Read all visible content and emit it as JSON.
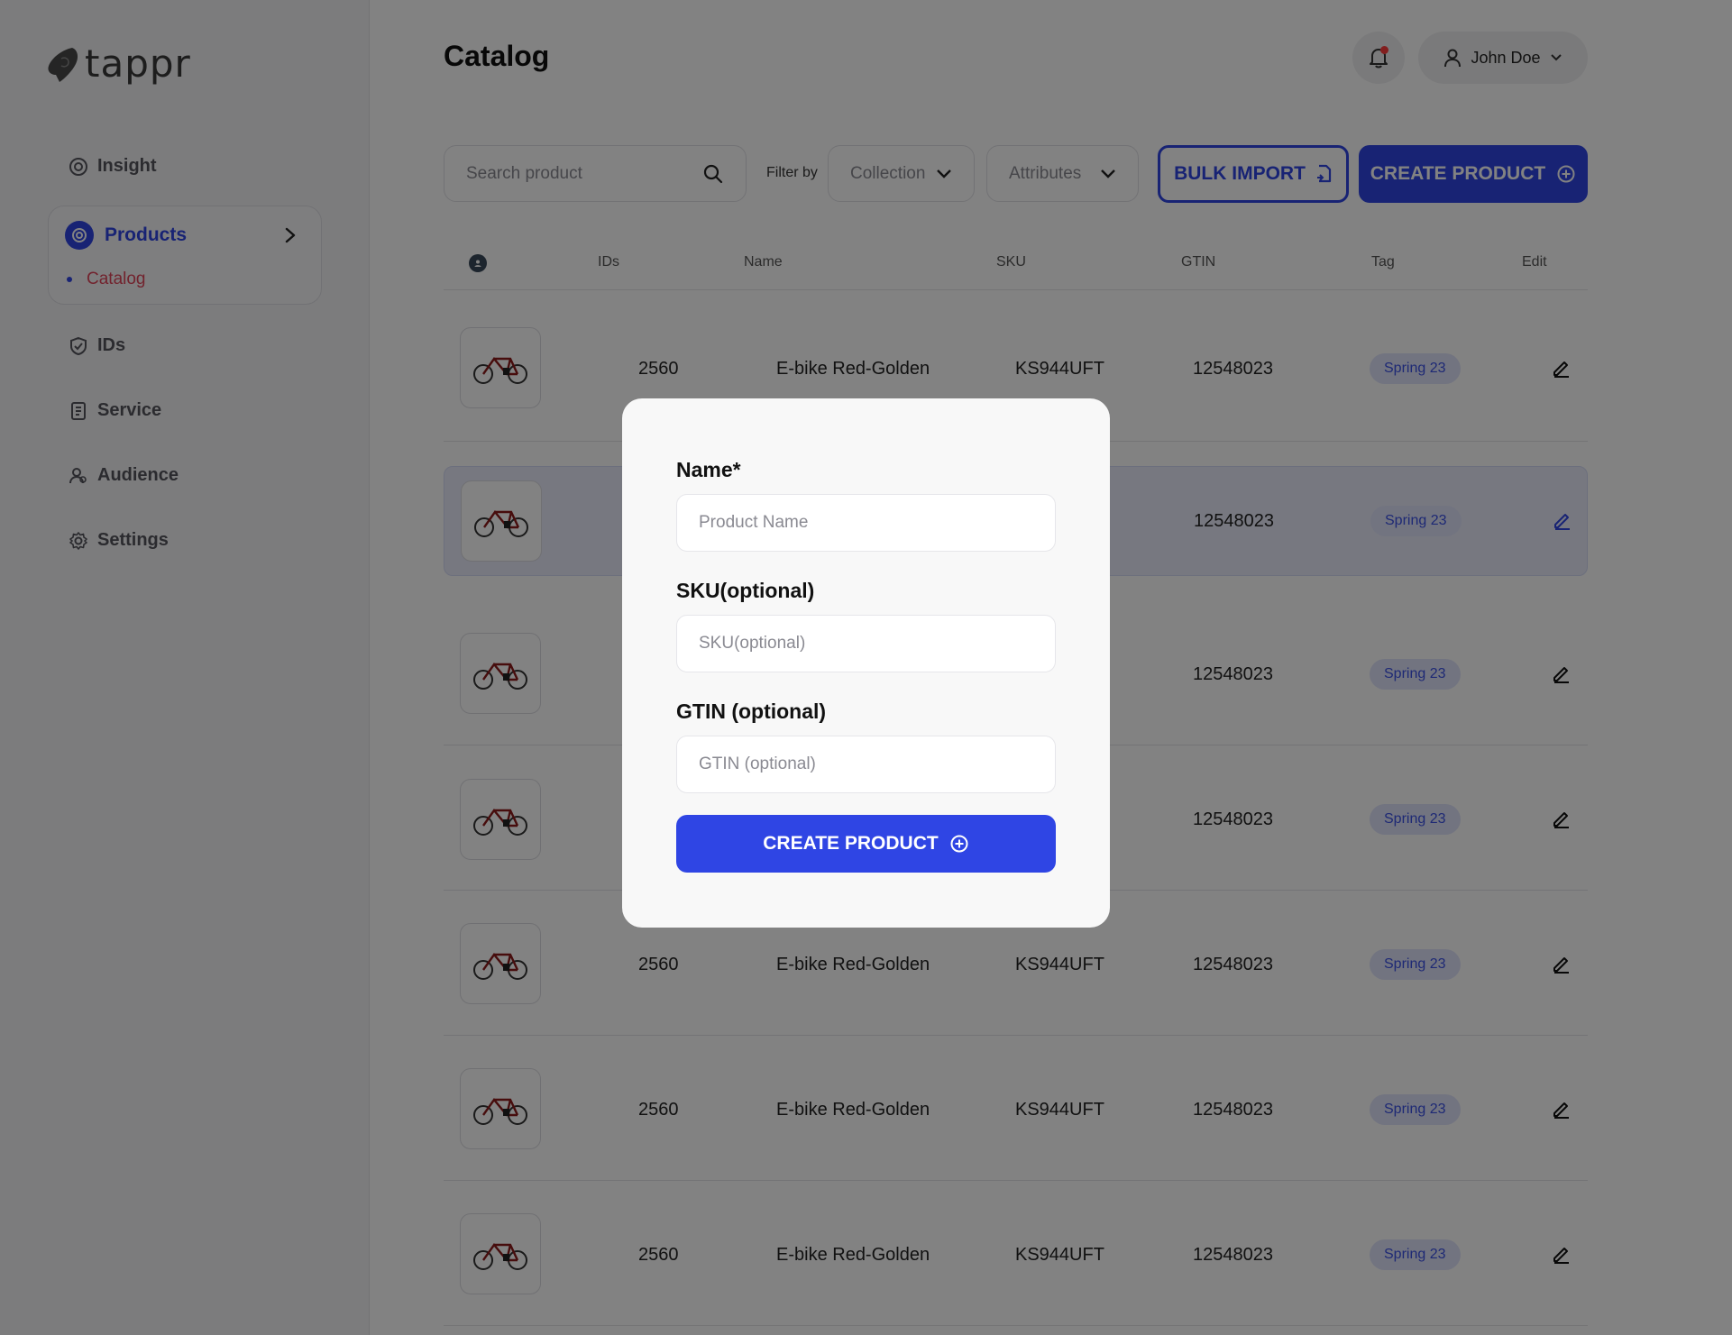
{
  "app": {
    "brand": "tappr"
  },
  "sidebar": {
    "items": [
      {
        "label": "Insight",
        "icon": "insight-icon"
      },
      {
        "label": "Products",
        "icon": "products-icon",
        "active": true,
        "subitems": [
          {
            "label": "Catalog"
          }
        ]
      },
      {
        "label": "IDs",
        "icon": "shield-icon"
      },
      {
        "label": "Service",
        "icon": "document-icon"
      },
      {
        "label": "Audience",
        "icon": "audience-icon"
      },
      {
        "label": "Settings",
        "icon": "gear-icon"
      }
    ]
  },
  "header": {
    "title": "Catalog",
    "user_name": "John Doe"
  },
  "toolbar": {
    "search_placeholder": "Search product",
    "filter_label": "Filter by",
    "collection_label": "Collection",
    "attributes_label": "Attributes",
    "bulk_import_label": "BULK IMPORT",
    "create_product_label": "CREATE PRODUCT"
  },
  "table": {
    "columns": [
      "IDs",
      "Name",
      "SKU",
      "GTIN",
      "Tag",
      "Edit"
    ],
    "rows": [
      {
        "id": "2560",
        "name": "E-bike Red-Golden",
        "sku": "KS944UFT",
        "gtin": "12548023",
        "tag": "Spring 23"
      },
      {
        "id": "",
        "name": "",
        "sku": "",
        "gtin": "12548023",
        "tag": "Spring 23",
        "highlighted": true
      },
      {
        "id": "",
        "name": "",
        "sku": "",
        "gtin": "12548023",
        "tag": "Spring 23"
      },
      {
        "id": "",
        "name": "",
        "sku": "",
        "gtin": "12548023",
        "tag": "Spring 23"
      },
      {
        "id": "2560",
        "name": "E-bike Red-Golden",
        "sku": "KS944UFT",
        "gtin": "12548023",
        "tag": "Spring 23"
      },
      {
        "id": "2560",
        "name": "E-bike Red-Golden",
        "sku": "KS944UFT",
        "gtin": "12548023",
        "tag": "Spring 23"
      },
      {
        "id": "2560",
        "name": "E-bike Red-Golden",
        "sku": "KS944UFT",
        "gtin": "12548023",
        "tag": "Spring 23"
      }
    ]
  },
  "modal": {
    "name_label": "Name*",
    "name_placeholder": "Product Name",
    "name_value": "",
    "sku_label": "SKU(optional)",
    "sku_placeholder": "SKU(optional)",
    "sku_value": "",
    "gtin_label": "GTIN (optional)",
    "gtin_placeholder": "GTIN (optional)",
    "gtin_value": "",
    "submit_label": "CREATE PRODUCT"
  },
  "colors": {
    "accent": "#2f45e4",
    "active_sub": "#e0455a",
    "tag_bg": "#dfe3fb",
    "overlay": "rgba(0,0,0,0.49)"
  }
}
